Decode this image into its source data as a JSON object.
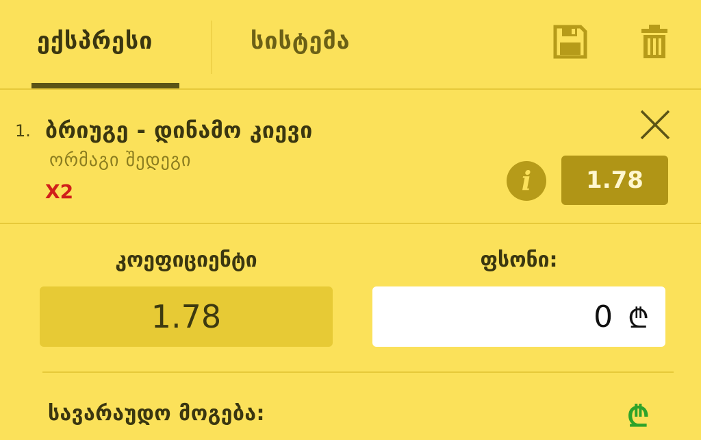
{
  "tabs": {
    "express_label": "ექსპრესი",
    "system_label": "სისტემა"
  },
  "toolbar": {
    "save_icon": "save-icon",
    "trash_icon": "trash-icon"
  },
  "bet": {
    "index": "1.",
    "match": "ბრიუგე - დინამო კიევი",
    "market": "ორმაგი შედეგი",
    "pick": "X2",
    "odds": "1.78"
  },
  "summary": {
    "coef_label": "კოეფიციენტი",
    "coef_value": "1.78",
    "stake_label": "ფსონი:",
    "stake_value": "0",
    "currency_symbol": "₾",
    "possible_win_label": "სავარაუდო მოგება:"
  },
  "colors": {
    "background": "#fbe15a",
    "accent_dark": "#5b5416",
    "odds_bg": "#b09516",
    "pick_red": "#d0201a",
    "win_green": "#2ea32a"
  }
}
